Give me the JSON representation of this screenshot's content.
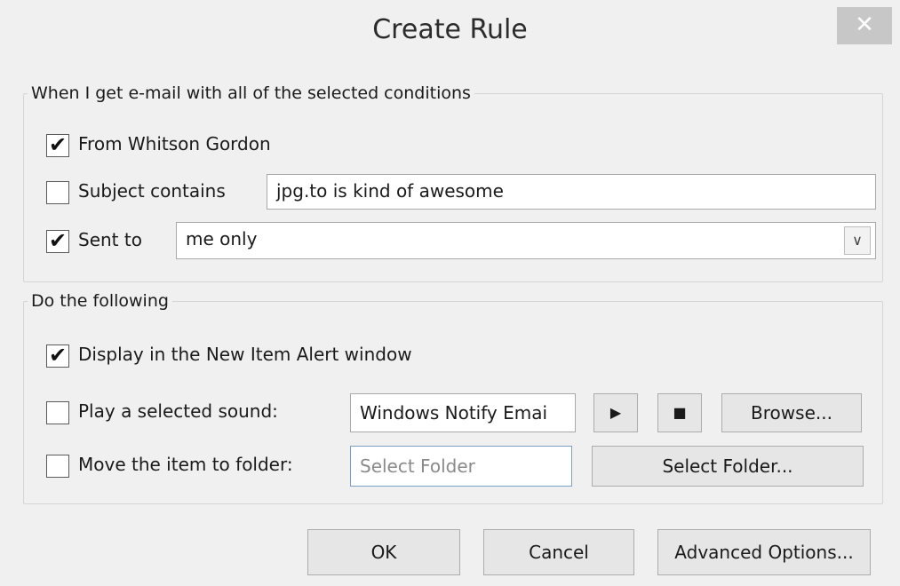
{
  "dialog": {
    "title": "Create Rule",
    "close_glyph": "✕"
  },
  "conditions": {
    "legend": "When I get e-mail with all of the selected conditions",
    "from": {
      "label": "From Whitson Gordon",
      "checked": true
    },
    "subject": {
      "label": "Subject contains",
      "checked": false,
      "value": "jpg.to is kind of awesome"
    },
    "sent_to": {
      "label": "Sent to",
      "checked": true,
      "value": "me only"
    }
  },
  "actions": {
    "legend": "Do the following",
    "display_alert": {
      "label": "Display in the New Item Alert window",
      "checked": true
    },
    "play_sound": {
      "label": "Play a selected sound:",
      "checked": false,
      "value": "Windows Notify Emai",
      "play_glyph": "▶",
      "stop_glyph": "■",
      "browse_label": "Browse..."
    },
    "move_item": {
      "label": "Move the item to folder:",
      "checked": false,
      "placeholder": "Select Folder",
      "select_label": "Select Folder..."
    }
  },
  "footer": {
    "ok_label": "OK",
    "cancel_label": "Cancel",
    "advanced_label": "Advanced Options..."
  },
  "checkmark_glyph": "✔",
  "dropdown_glyph": "∨",
  "icons": [
    "close-icon",
    "checkmark-icon",
    "chevron-down-icon",
    "play-icon",
    "stop-icon"
  ]
}
